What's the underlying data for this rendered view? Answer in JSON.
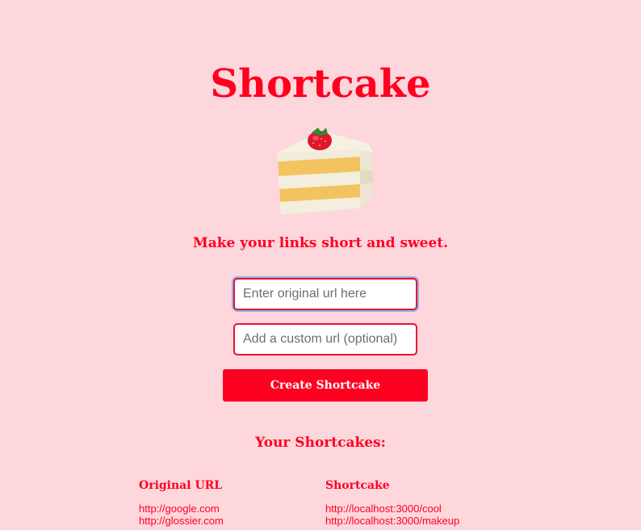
{
  "header": {
    "title": "Shortcake"
  },
  "hero": {
    "image_icon": "strawberry-shortcake-icon",
    "tagline": "Make your links short and sweet."
  },
  "form": {
    "original_url": {
      "value": "",
      "placeholder": "Enter original url here"
    },
    "custom_url": {
      "value": "",
      "placeholder": "Add a custom url (optional)"
    },
    "submit_label": "Create Shortcake"
  },
  "list": {
    "title": "Your Shortcakes:",
    "columns": [
      "Original URL",
      "Shortcake"
    ],
    "rows": [
      {
        "original": "http://google.com",
        "short": "http://localhost:3000/cool"
      },
      {
        "original": "http://glossier.com",
        "short": "http://localhost:3000/makeup"
      }
    ]
  },
  "colors": {
    "background": "#fed7dd",
    "accent": "#fe0020",
    "input_border": "#e8122f",
    "focus_ring": "#8fb3f0"
  }
}
